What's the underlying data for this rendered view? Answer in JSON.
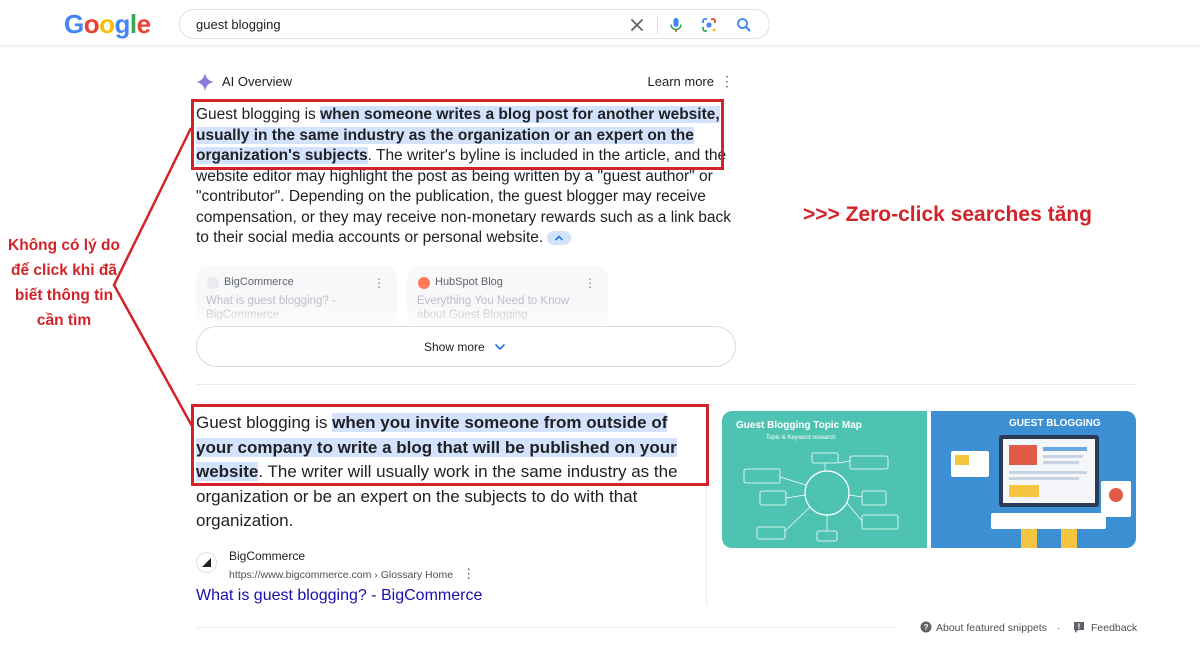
{
  "header": {
    "logo_letters": [
      {
        "ch": "G",
        "color": "#4285f4"
      },
      {
        "ch": "o",
        "color": "#ea4335"
      },
      {
        "ch": "o",
        "color": "#fbbc05"
      },
      {
        "ch": "g",
        "color": "#4285f4"
      },
      {
        "ch": "l",
        "color": "#34a853"
      },
      {
        "ch": "e",
        "color": "#ea4335"
      }
    ],
    "search_query": "guest blogging",
    "icons": [
      "close-icon",
      "mic-icon",
      "lens-icon",
      "search-icon"
    ]
  },
  "ai_overview": {
    "title": "AI Overview",
    "learn_more": "Learn more",
    "para_intro": "Guest blogging is ",
    "para_highlight": "when someone writes a blog post for another website, usually in the same industry as the organization or an expert on the organization's subjects",
    "para_rest": ". The writer's byline is included in the article, and the website editor may highlight the post as being written by a \"guest author\" or \"contributor\". Depending on the publication, the guest blogger may receive compensation, or they may receive non-monetary rewards such as a link back to their social media accounts or personal website.",
    "sources": [
      {
        "site": "BigCommerce",
        "title": "What is guest blogging? - BigCommerce",
        "color": "#222222"
      },
      {
        "site": "HubSpot Blog",
        "title": "Everything You Need to Know about Guest Blogging",
        "color": "#ff7a59"
      }
    ],
    "show_more": "Show more"
  },
  "featured_snippet": {
    "intro": "Guest blogging is ",
    "highlight": "when you invite someone from outside of your company to write a blog that will be published on your website",
    "rest": ". The writer will usually work in the same industry as the organization or be an expert on the subjects to do with that organization.",
    "site_name": "BigCommerce",
    "url": "https://www.bigcommerce.com › Glossary Home",
    "link": "What is guest blogging? - BigCommerce",
    "image1_title": "Guest Blogging Topic Map",
    "image1_subtitle": "Topic & Keyword research",
    "image2_title": "GUEST BLOGGING"
  },
  "footer": {
    "about": "About featured snippets",
    "feedback": "Feedback"
  },
  "annotations": {
    "left_note": "Không có lý do để click khi đã biết thông tin cần tìm",
    "right_note": ">>> Zero-click searches tăng",
    "color": "#d2232a"
  }
}
